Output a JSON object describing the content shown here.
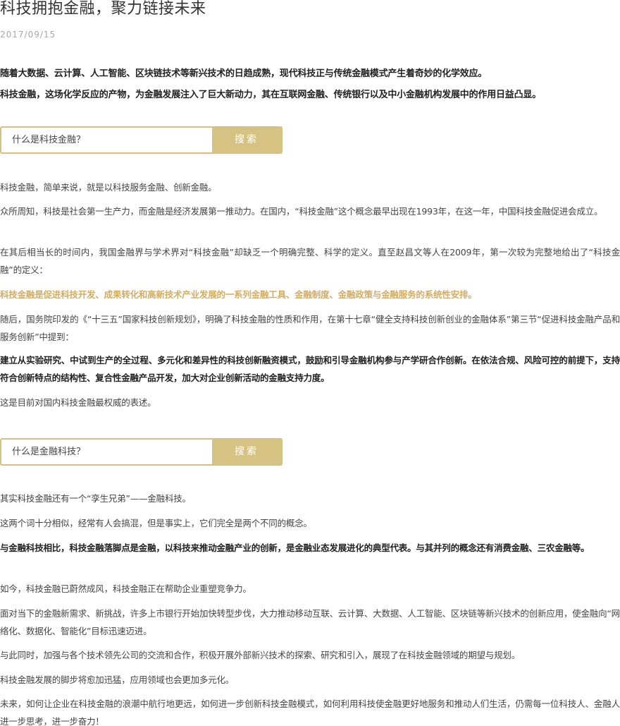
{
  "article": {
    "title": "科技拥抱金融，聚力链接未来",
    "date": "2017/09/15",
    "lead": [
      "随着大数据、云计算、人工智能、区块链技术等新兴技术的日趋成熟，现代科技正与传统金融模式产生着奇妙的化学效应。",
      "科技金融，这场化学反应的产物，为金融发展注入了巨大新动力，其在互联网金融、传统银行以及中小金融机构发展中的作用日益凸显。"
    ],
    "section1": {
      "question": "什么是科技金融？",
      "button": "搜索",
      "paragraphs": [
        "科技金融，简单来说，就是以科技服务金融、创新金融。",
        "众所周知，科技是社会第一生产力，而金融是经济发展第一推动力。在国内，“科技金融”这个概念最早出现在1993年，在这一年，中国科技金融促进会成立。",
        "在其后相当长的时间内，我国金融界与学术界对“科技金融”却缺乏一个明确完整、科学的定义。直至赵昌文等人在2009年，第一次较为完整地给出了“科技金融”的定义：",
        "科技金融是促进科技开发、成果转化和高新技术产业发展的一系列金融工具、金融制度、金融政策与金融服务的系统性安排。",
        "随后，国务院印发的《“十三五”国家科技创新规划》，明确了科技金融的性质和作用，在第十七章“健全支持科技创新创业的金融体系”第三节“促进科技金融产品和服务创新”中提到：",
        "建立从实验研究、中试到生产的全过程、多元化和差异性的科技创新融资模式，鼓励和引导金融机构参与产学研合作创新。在依法合规、风险可控的前提下，支持符合创新特点的结构性、复合性金融产品开发，加大对企业创新活动的金融支持力度。",
        "这是目前对国内科技金融最权威的表述。"
      ]
    },
    "section2": {
      "question": "什么是金融科技？",
      "button": "搜索",
      "paragraphs": [
        "其实科技金融还有一个“孪生兄弟”——金融科技。",
        "这两个词十分相似，经常有人会搞混，但是事实上，它们完全是两个不同的概念。",
        "与金融科技相比，科技金融落脚点是金融，以科技来推动金融产业的创新，是金融业态发展进化的典型代表。与其并列的概念还有消费金融、三农金融等。",
        "如今，科技金融已蔚然成风，科技金融正在帮助企业重塑竞争力。",
        "面对当下的金融新需求、新挑战，许多上市银行开始加快转型步伐，大力推动移动互联、云计算、大数据、人工智能、区块链等新兴技术的创新应用，使金融向“网络化、数据化、智能化”目标迅速迈进。",
        "与此同时，加强与各个技术领先公司的交流和合作，积极开展外部新兴技术的探索、研究和引入，展现了在科技金融领域的期望与规划。",
        "科技金融发展的脚步将愈加迅猛，应用领域也会更加多元化。",
        "未来，如何让企业在科技金融的浪潮中航行地更远，如何进一步创新科技金融模式，如何利用科技使金融更好地服务和推动人们生活，仍需每一位科技人、金融人进一步思考，进一步奋力！"
      ]
    },
    "colors": {
      "accent": "#d6c383",
      "highlight": "#d3ad63",
      "date": "#a8a8a8"
    }
  }
}
